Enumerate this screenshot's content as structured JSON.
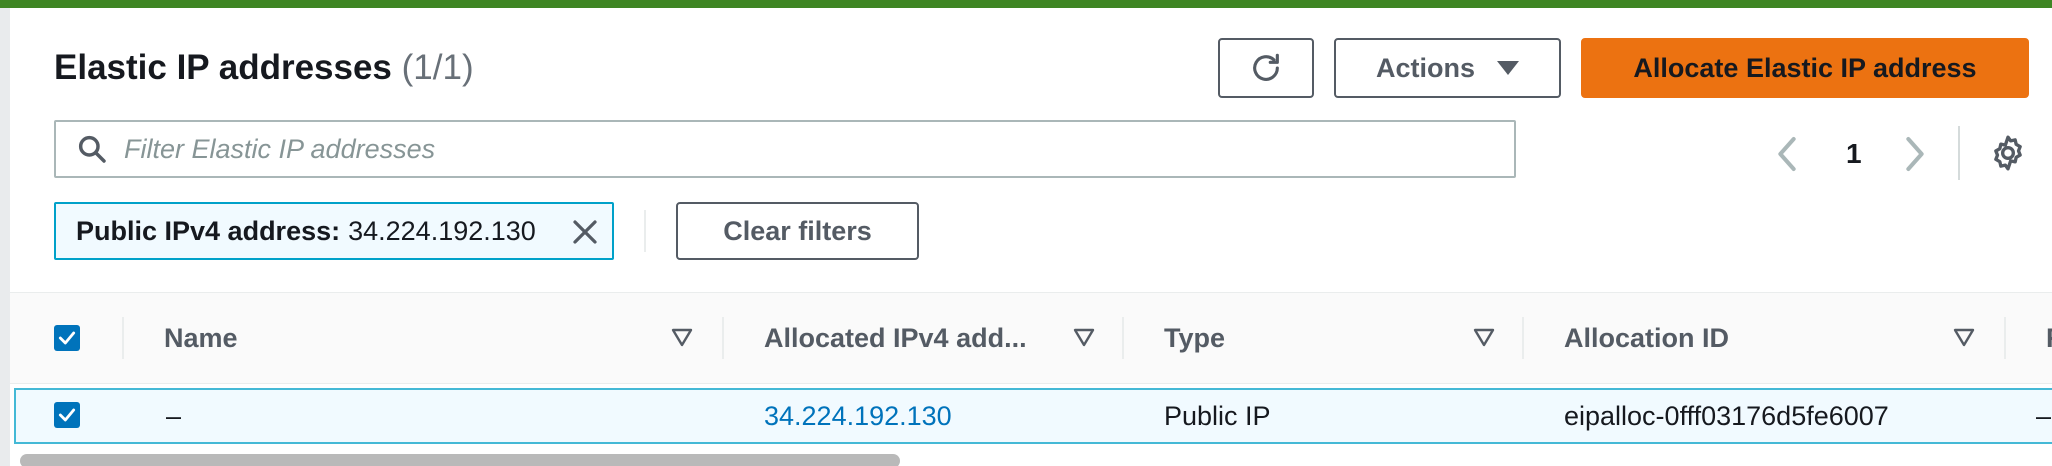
{
  "header": {
    "title": "Elastic IP addresses",
    "count": "(1/1)",
    "actions_label": "Actions",
    "allocate_label": "Allocate Elastic IP address"
  },
  "filter": {
    "placeholder": "Filter Elastic IP addresses",
    "value": "",
    "token_key": "Public IPv4 address:",
    "token_value": "34.224.192.130",
    "clear_label": "Clear filters"
  },
  "pagination": {
    "current_page": "1"
  },
  "table": {
    "columns": [
      "Name",
      "Allocated IPv4 add...",
      "Type",
      "Allocation ID",
      "R"
    ],
    "rows": [
      {
        "selected": true,
        "name": "–",
        "ipv4": "34.224.192.130",
        "type": "Public IP",
        "allocation_id": "eipalloc-0fff03176d5fe6007",
        "extra": "–"
      }
    ]
  },
  "colors": {
    "accent": "#ec7211",
    "top_bar": "#3f8624",
    "link": "#0073bb",
    "token_border": "#00a1c9"
  }
}
